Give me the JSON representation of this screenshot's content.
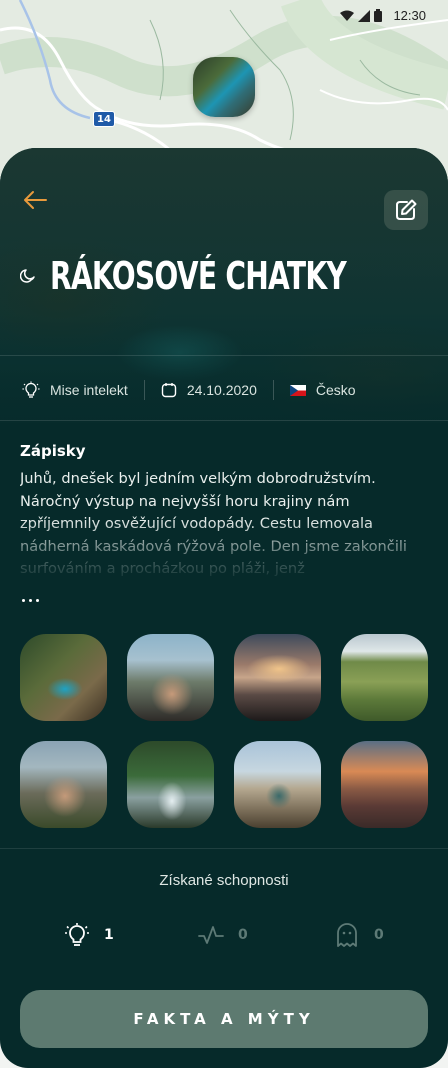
{
  "status_bar": {
    "time": "12:30"
  },
  "map": {
    "road_number": "14"
  },
  "header": {
    "title": "RÁKOSOVÉ CHATKY",
    "back_icon": "arrow-left-icon",
    "edit_icon": "edit-icon",
    "mode_icon": "moon-icon"
  },
  "meta": {
    "mission": {
      "icon": "lightbulb-icon",
      "label": "Mise intelekt"
    },
    "date": {
      "icon": "calendar-icon",
      "label": "24.10.2020"
    },
    "country": {
      "icon": "czech-flag-icon",
      "label": "Česko"
    }
  },
  "notes": {
    "title": "Zápisky",
    "text": "Juhů, dnešek byl jedním velkým dobrodružstvím. Náročný výstup na nejvyšší horu krajiny nám zpříjemnily osvěžující vodopády. Cestu lemovala nádherná kaskádová rýžová pole. Den jsme zakončili surfováním a procházkou po pláži, jenž",
    "more_icon": "more-dots-icon"
  },
  "gallery": [
    {
      "name": "photo-pool"
    },
    {
      "name": "photo-couple-lake"
    },
    {
      "name": "photo-beach-sunset"
    },
    {
      "name": "photo-rice-terraces"
    },
    {
      "name": "photo-couple-drinks"
    },
    {
      "name": "photo-waterfall"
    },
    {
      "name": "photo-temple-pool"
    },
    {
      "name": "photo-volcano-sunrise"
    }
  ],
  "skills": {
    "title": "Získané schopnosti",
    "items": [
      {
        "icon": "lightbulb-icon",
        "value": "1"
      },
      {
        "icon": "pulse-icon",
        "value": "0"
      },
      {
        "icon": "ghost-icon",
        "value": "0"
      }
    ]
  },
  "cta": {
    "label": "FAKTA A MÝTY"
  },
  "colors": {
    "background": "#062a2a",
    "accent_orange": "#e89a3c",
    "button": "#5d7a70",
    "muted": "#5d7a76"
  }
}
